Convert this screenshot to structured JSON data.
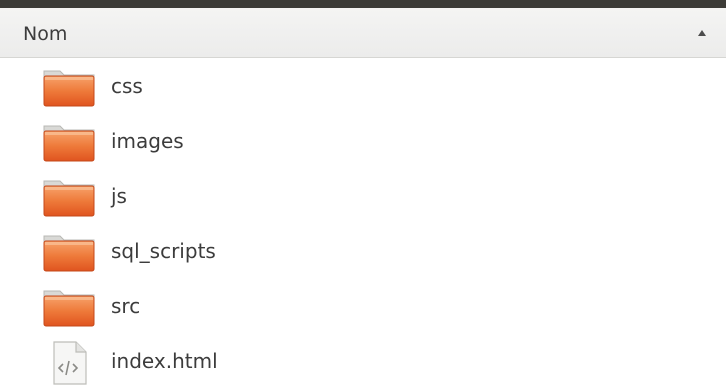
{
  "header": {
    "column_label": "Nom",
    "sort_icon": "sort-ascending-icon"
  },
  "items": [
    {
      "name": "css",
      "type": "folder",
      "icon": "folder-icon"
    },
    {
      "name": "images",
      "type": "folder",
      "icon": "folder-icon"
    },
    {
      "name": "js",
      "type": "folder",
      "icon": "folder-icon"
    },
    {
      "name": "sql_scripts",
      "type": "folder",
      "icon": "folder-icon"
    },
    {
      "name": "src",
      "type": "folder",
      "icon": "folder-icon"
    },
    {
      "name": "index.html",
      "type": "file",
      "icon": "html-file-icon"
    }
  ],
  "colors": {
    "folder_orange": "#e8652b",
    "folder_light": "#f7a26b",
    "header_bg": "#f2f2f1",
    "top_border": "#3c3b37",
    "text": "#3c3c3c"
  }
}
